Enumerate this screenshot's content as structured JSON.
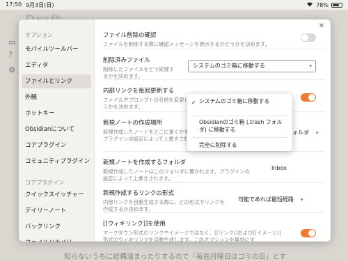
{
  "status_bar": {
    "time": "17:50",
    "date": "9月3日(日)",
    "battery_pct": "78%",
    "battery_level": 0.78
  },
  "background": {
    "title": "Draft",
    "text": "知らないうちに結構溜まったりするので「毎週月曜日はゴミの日」とす"
  },
  "sidebar": {
    "sections": [
      {
        "label": "オプション",
        "items": [
          "モバイルツールバー",
          "エディタ",
          "ファイルとリンク",
          "外観",
          "ホットキー",
          "Obsidianについて",
          "コアプラグイン",
          "コミュニティプラグイン"
        ]
      },
      {
        "label": "コアプラグイン",
        "items": [
          "クイックスイッチャー",
          "デイリーノート",
          "バックリンク",
          "ファイルリカバリー"
        ]
      }
    ],
    "active_item": "ファイルとリンク"
  },
  "settings": {
    "confirm_delete": {
      "name": "ファイル削除の確認",
      "desc": "ファイルを削除する際に確認メッセージを表示するかどうかを決めます。",
      "enabled": false
    },
    "deleted_files": {
      "name": "削除済みファイル",
      "desc": "削除したファイルをどう処理するかを決めます。",
      "value": "システムのゴミ箱に移動する"
    },
    "auto_update_links": {
      "name": "内部リンクを毎回更新する",
      "desc": "ファイルやプロンプトの名前を変更した際に内部リンクを自動で更新するかどうかを決めます。",
      "enabled": true
    },
    "new_note_location": {
      "name": "新規ノートの作成場所",
      "desc": "新規作成したノートをどこに置くかを決めます。プラグインの設定によって上書きされます。",
      "value": "以下で指定されたフォルダ"
    },
    "new_note_folder": {
      "name": "新規ノートを作成するフォルダ",
      "desc": "新規作成したノートはこのフォルダに置かれます。プラグインの設定によって上書きされます。",
      "value": "Inbox"
    },
    "new_link_format": {
      "name": "新規作成するリンクの形式",
      "desc": "内部リンクを自動生成する際に、どの形式でリンクを作成するか決めます。",
      "value": "可能であれば最短経路"
    },
    "wikilinks": {
      "name": "[[ウィキリンク]]を使用",
      "desc": "マークダウン形式のリンクやイメージではなく、[[リンク]]および[[イメージ]]形式のウィキリンクを自動生成します。このオプションを無効にす",
      "enabled": true
    }
  },
  "dropdown": {
    "options": [
      "システムのゴミ箱に移動する",
      "Obsidianのゴミ箱 (.trash フォルダ) に移動する",
      "完全に削除する"
    ],
    "selected_index": 0,
    "check_glyph": "✓"
  },
  "colors": {
    "accent": "#f07a2f",
    "toggle_off": "#d9d9d9"
  }
}
